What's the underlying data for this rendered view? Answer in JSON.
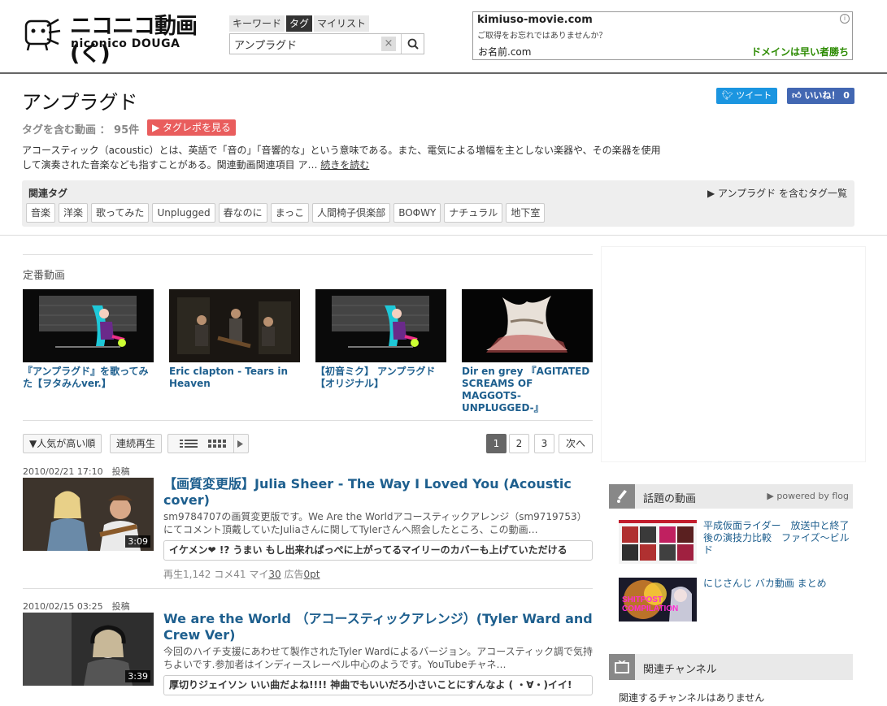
{
  "header": {
    "logo_main": "ニコニコ動画(く)",
    "logo_sub": "niconico DOUGA",
    "search_tabs": [
      "キーワード",
      "タグ",
      "マイリスト"
    ],
    "search_active_tab": "タグ",
    "search_value": "アンプラグド",
    "search_clear": "×"
  },
  "ad": {
    "domain": "kimiuso-movie.com",
    "question": "ご取得をお忘れではありませんか？",
    "brand": "お名前.com",
    "cta": "ドメインは早い者勝ち",
    "info_icon": "i"
  },
  "page": {
    "title": "アンプラグド",
    "tweet_label": "ツイート",
    "like_label": "いいね！ 0",
    "count_label": "タグを含む動画 ： 95件",
    "tagrepo_label": "▶ タグレポを見る",
    "description": "アコースティック（acoustic）とは、英語で「音の」「音響的な」という意味である。また、電気による増幅を主としない楽器や、その楽器を使用して演奏された音楽なども指すことがある。関連動画関連項目 ア…",
    "readmore": "続きを読む"
  },
  "related": {
    "label": "関連タグ",
    "all_link": "▶ アンプラグド を含むタグ一覧",
    "tags": [
      "音楽",
      "洋楽",
      "歌ってみた",
      "Unplugged",
      "春なのに",
      "まっこ",
      "人間椅子倶楽部",
      "BOΦWY",
      "ナチュラル",
      "地下室"
    ]
  },
  "featured": {
    "heading": "定番動画",
    "items": [
      {
        "title": "『アンプラグド』を歌ってみた【ヲタみんver.】"
      },
      {
        "title": "Eric clapton - Tears in Heaven"
      },
      {
        "title": "【初音ミク】 アンプラグド【オリジナル】"
      },
      {
        "title": "Dir en grey 『AGITATED SCREAMS OF MAGGOTS-UNPLUGGED-』"
      }
    ]
  },
  "toolbar": {
    "sort_label": "▼人気が高い順",
    "continuous_label": "連続再生",
    "pages": [
      "1",
      "2",
      "3"
    ],
    "current_page": "1",
    "next_label": "次へ"
  },
  "videos": [
    {
      "date": "2010/02/21 17:10　投稿",
      "title": "【画質変更版】Julia Sheer - The Way I Loved You (Acoustic cover)",
      "description": "sm9784707の画質変更版です。We Are the Worldアコースティックアレンジ（sm9719753）にてコメント頂戴していたJuliaさんに関してTylerさんへ照会したところ、この動画…",
      "comment": "イケメン❤ !? うまい もし出来ればっぺに上がってるマイリーのカバーも上げていただける",
      "duration": "3:09",
      "views_label": "再生",
      "views": "1,142",
      "comments_label": "コメ",
      "comments": "41",
      "mylist_label": "マイ",
      "mylist": "30",
      "ad_label": "広告",
      "ad_points": "0pt"
    },
    {
      "date": "2010/02/15 03:25　投稿",
      "title": "We are the World （アコースティックアレンジ）(Tyler Ward and Crew Ver)",
      "description": "今回のハイチ支援にあわせて製作されたTyler Wardによるバージョン。アコースティック調で気持ちよいです.参加者はインディースレーベル中心のようです。YouTubeチャネ…",
      "comment": "厚切りジェイソン いい曲だよね!!!! 神曲でもいいだろ小さいことにすんなよ ( ・∀・)イイ!",
      "duration": "3:39"
    }
  ],
  "sidebar": {
    "trend_label": "話題の動画",
    "powered": "▶ powered by flog",
    "trend_items": [
      {
        "title": "平成仮面ライダー　放送中と終了後の演技力比較　ファイズ～ビルド"
      },
      {
        "title": "にじさんじ バカ動画 まとめ"
      }
    ],
    "trend_thumb_text": "SHITPOST COMPILATION",
    "channel_label": "関連チャンネル",
    "channel_empty": "関連するチャンネルはありません"
  },
  "colors": {
    "link": "#1e5f8e",
    "tagrepo": "#e95d5d",
    "tweet": "#1b95e0",
    "like": "#4267b2",
    "ad_cta": "#2b8a00"
  }
}
